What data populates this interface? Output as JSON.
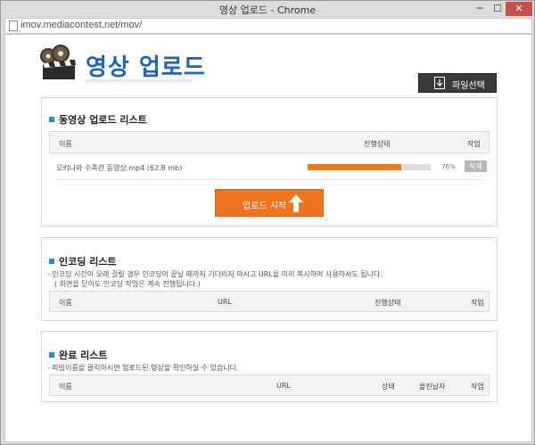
{
  "window": {
    "title": "영상 업로드 - Chrome",
    "min": "─",
    "max": "☐",
    "close": "✕"
  },
  "address": {
    "url": "imov.mediacontest.net/mov/"
  },
  "logo": {
    "text": "영상 업로드"
  },
  "file_button": {
    "label": "파일선택"
  },
  "upload_section": {
    "title": "동영상 업로드 리스트",
    "columns": {
      "name": "이름",
      "status": "진행상태",
      "action": "작업"
    },
    "rows": [
      {
        "filename": "오키나와 수족관 동영상.mp4 (62.8 mb)",
        "progress": 76,
        "progress_label": "76%",
        "action": "삭제"
      }
    ],
    "start_button": "업로드 시작"
  },
  "encoding_section": {
    "title": "인코딩 리스트",
    "note1": "- 인코딩 시간이 오래 걸릴 경우 인코딩이 끝날 때까지 기다리지 마시고 URL을 미리 복사하여 사용하셔도 됩니다.",
    "note2": "( 화면을 닫아도 인코딩 작업은 계속 진행됩니다.)",
    "columns": {
      "name": "이름",
      "url": "URL",
      "status": "진행상태",
      "action": "작업"
    }
  },
  "complete_section": {
    "title": "완료 리스트",
    "note": "- 파일이름을 클릭하시면 업로드된 영상을 확인하실 수 있습니다.",
    "columns": {
      "name": "이름",
      "url": "URL",
      "status": "상태",
      "date": "올린날자",
      "action": "작업"
    }
  },
  "colors": {
    "accent": "#f37a10",
    "brand": "#1f64b4",
    "section_marker": "#2a8fd0"
  }
}
